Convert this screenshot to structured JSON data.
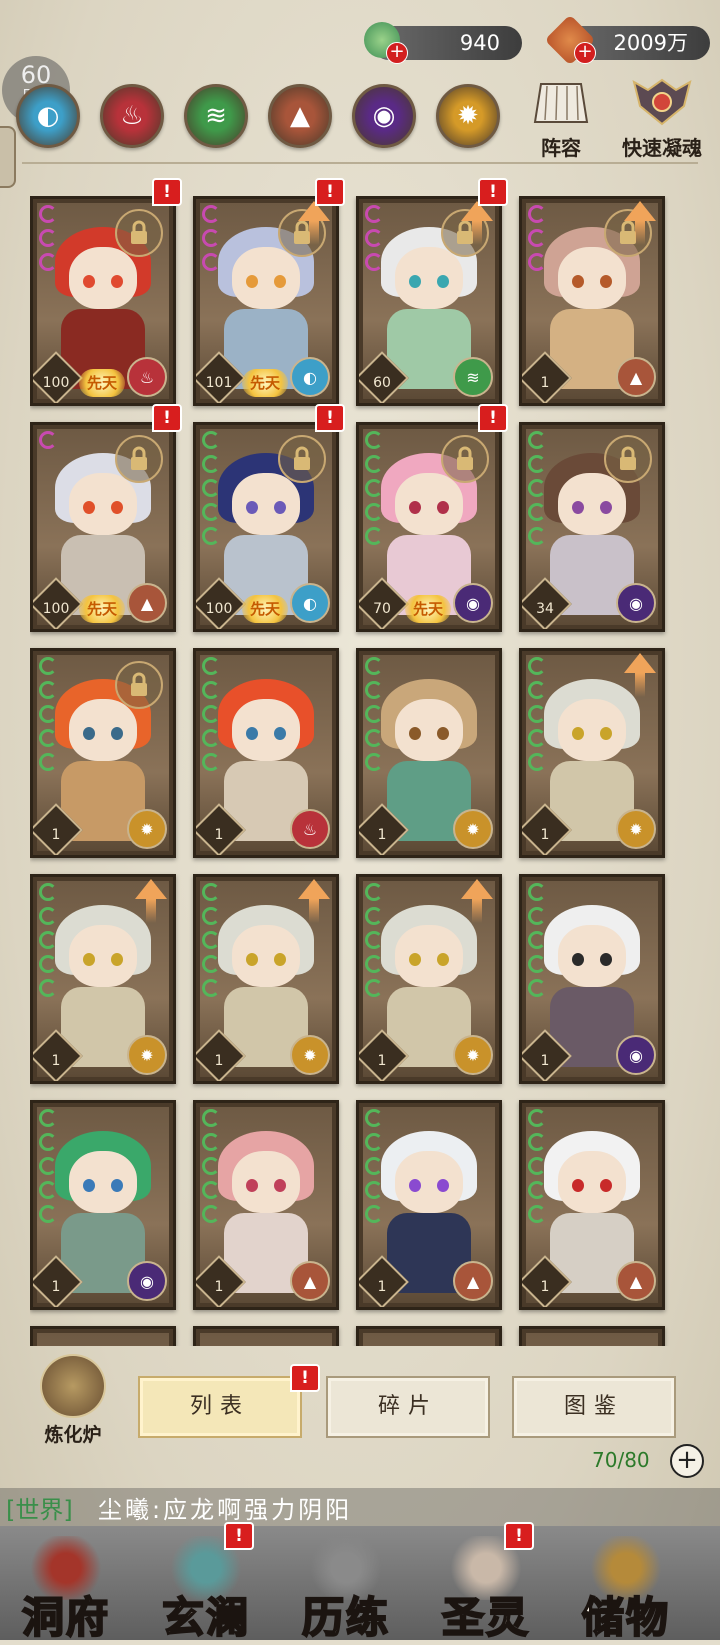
{
  "status": {
    "fps_value": "60",
    "fps_unit": "FPS"
  },
  "currencies": [
    {
      "name": "jade",
      "value": "940",
      "icon": "jade-coin-icon",
      "color": "#3e8f55"
    },
    {
      "name": "spirit-stone",
      "value": "2009万",
      "icon": "spirit-stone-icon",
      "color": "#b8532a"
    }
  ],
  "element_filters": [
    {
      "name": "water",
      "glyph": "◐",
      "color": "#3d9fc8"
    },
    {
      "name": "fire",
      "glyph": "♨",
      "color": "#b8323a"
    },
    {
      "name": "wind",
      "glyph": "≋",
      "color": "#3f9a4a"
    },
    {
      "name": "earth",
      "glyph": "▲",
      "color": "#a8553a"
    },
    {
      "name": "dark",
      "glyph": "◉",
      "color": "#5a2a86"
    },
    {
      "name": "light",
      "glyph": "✹",
      "color": "#d59a28"
    }
  ],
  "top_buttons": {
    "lineup": "阵容",
    "quick_condense": "快速凝魂"
  },
  "cards": [
    {
      "level": "100",
      "element": "fire",
      "talent": "先天",
      "locked": true,
      "badge": true,
      "upgrade": false,
      "hair": "#d23a2a",
      "body": "#8a2a22",
      "eye": "#e04a30",
      "stars": 3,
      "star_color": "#c84ab0"
    },
    {
      "level": "101",
      "element": "water",
      "talent": "先天",
      "locked": true,
      "badge": true,
      "upgrade": true,
      "hair": "#b9c1dd",
      "body": "#9bb2c6",
      "eye": "#e59a3a",
      "stars": 3,
      "star_color": "#c84ab0"
    },
    {
      "level": "60",
      "element": "wind",
      "talent": "",
      "locked": true,
      "badge": true,
      "upgrade": true,
      "hair": "#e9e9e9",
      "body": "#9fc9a6",
      "eye": "#3aa7b0",
      "stars": 3,
      "star_color": "#c84ab0"
    },
    {
      "level": "1",
      "element": "earth",
      "talent": "",
      "locked": true,
      "badge": false,
      "upgrade": true,
      "hair": "#cfa394",
      "body": "#d4b183",
      "eye": "#b55a2a",
      "stars": 3,
      "star_color": "#c84ab0"
    },
    {
      "level": "100",
      "element": "earth",
      "talent": "先天",
      "locked": true,
      "badge": true,
      "upgrade": false,
      "hair": "#dcdde6",
      "body": "#c9bfb2",
      "eye": "#e0502a",
      "stars": 1,
      "star_color": "#c84ab0"
    },
    {
      "level": "100",
      "element": "water",
      "talent": "先天",
      "locked": true,
      "badge": true,
      "upgrade": false,
      "hair": "#2c3476",
      "body": "#b9c2cd",
      "eye": "#6a5ab8",
      "stars": 5,
      "star_color": "#54b65a"
    },
    {
      "level": "70",
      "element": "dark",
      "talent": "先天",
      "locked": true,
      "badge": true,
      "upgrade": false,
      "hair": "#f0a8c0",
      "body": "#e8c9d4",
      "eye": "#b0304a",
      "stars": 5,
      "star_color": "#54b65a"
    },
    {
      "level": "34",
      "element": "dark",
      "talent": "",
      "locked": true,
      "badge": false,
      "upgrade": false,
      "hair": "#6a4a38",
      "body": "#c9c1c9",
      "eye": "#8a4aa0",
      "stars": 5,
      "star_color": "#54b65a"
    },
    {
      "level": "1",
      "element": "light",
      "talent": "",
      "locked": true,
      "badge": false,
      "upgrade": false,
      "hair": "#e8642a",
      "body": "#c79a66",
      "eye": "#3a6a8a",
      "stars": 5,
      "star_color": "#54b65a"
    },
    {
      "level": "1",
      "element": "fire",
      "talent": "",
      "locked": false,
      "badge": false,
      "upgrade": false,
      "hair": "#e8502a",
      "body": "#d7c9b4",
      "eye": "#3a7aa8",
      "stars": 5,
      "star_color": "#54b65a"
    },
    {
      "level": "1",
      "element": "light",
      "talent": "",
      "locked": false,
      "badge": false,
      "upgrade": false,
      "hair": "#c9a77a",
      "body": "#5f9e86",
      "eye": "#8a5a2a",
      "stars": 5,
      "star_color": "#54b65a"
    },
    {
      "level": "1",
      "element": "light",
      "talent": "",
      "locked": false,
      "badge": false,
      "upgrade": true,
      "hair": "#dcdcd2",
      "body": "#d1c6a9",
      "eye": "#c9a42a",
      "stars": 5,
      "star_color": "#54b65a"
    },
    {
      "level": "1",
      "element": "light",
      "talent": "",
      "locked": false,
      "badge": false,
      "upgrade": true,
      "hair": "#dcdcd2",
      "body": "#d1c6a9",
      "eye": "#c9a42a",
      "stars": 5,
      "star_color": "#54b65a"
    },
    {
      "level": "1",
      "element": "light",
      "talent": "",
      "locked": false,
      "badge": false,
      "upgrade": true,
      "hair": "#dcdcd2",
      "body": "#d1c6a9",
      "eye": "#c9a42a",
      "stars": 5,
      "star_color": "#54b65a"
    },
    {
      "level": "1",
      "element": "light",
      "talent": "",
      "locked": false,
      "badge": false,
      "upgrade": true,
      "hair": "#dcdcd2",
      "body": "#d1c6a9",
      "eye": "#c9a42a",
      "stars": 5,
      "star_color": "#54b65a"
    },
    {
      "level": "1",
      "element": "dark",
      "talent": "",
      "locked": false,
      "badge": false,
      "upgrade": false,
      "hair": "#efefef",
      "body": "#6a5a66",
      "eye": "#2a2a2a",
      "stars": 5,
      "star_color": "#54b65a"
    },
    {
      "level": "1",
      "element": "dark",
      "talent": "",
      "locked": false,
      "badge": false,
      "upgrade": false,
      "hair": "#3aa86a",
      "body": "#7a9a8a",
      "eye": "#3a7ab8",
      "stars": 5,
      "star_color": "#54b65a"
    },
    {
      "level": "1",
      "element": "earth",
      "talent": "",
      "locked": false,
      "badge": false,
      "upgrade": false,
      "hair": "#e6a4a4",
      "body": "#e2d3cc",
      "eye": "#c0405a",
      "stars": 5,
      "star_color": "#54b65a"
    },
    {
      "level": "1",
      "element": "earth",
      "talent": "",
      "locked": false,
      "badge": false,
      "upgrade": false,
      "hair": "#eceff2",
      "body": "#2e3656",
      "eye": "#8a4ad0",
      "stars": 5,
      "star_color": "#54b65a"
    },
    {
      "level": "1",
      "element": "earth",
      "talent": "",
      "locked": false,
      "badge": false,
      "upgrade": false,
      "hair": "#f2f2f2",
      "body": "#d6cfc5",
      "eye": "#c82a2a",
      "stars": 5,
      "star_color": "#54b65a"
    }
  ],
  "bottom": {
    "furnace_label": "炼化炉",
    "tabs": [
      {
        "label": "列表",
        "active": true,
        "badge": true
      },
      {
        "label": "碎片",
        "active": false,
        "badge": false
      },
      {
        "label": "图鉴",
        "active": false,
        "badge": false
      }
    ],
    "capacity": "70/80",
    "add_symbol": "+"
  },
  "chat": {
    "channel": "[世界]",
    "message": "尘曦:应龙啊强力阴阳"
  },
  "nav": [
    {
      "label": "洞府",
      "color": "#a4352a",
      "badge": false
    },
    {
      "label": "玄澜",
      "color": "#5a9a9a",
      "badge": true
    },
    {
      "label": "历练",
      "color": "#8a8a8a",
      "badge": false
    },
    {
      "label": "圣灵",
      "color": "#c9b8a8",
      "badge": true
    },
    {
      "label": "储物",
      "color": "#b58a3a",
      "badge": false
    }
  ],
  "element_glyphs": {
    "water": "◐",
    "fire": "♨",
    "wind": "≋",
    "earth": "▲",
    "dark": "◉",
    "light": "✹"
  },
  "element_colors": {
    "water": "#3d9fc8",
    "fire": "#b8323a",
    "wind": "#3f9a4a",
    "earth": "#a8553a",
    "dark": "#4a2a76",
    "light": "#c9922a"
  }
}
